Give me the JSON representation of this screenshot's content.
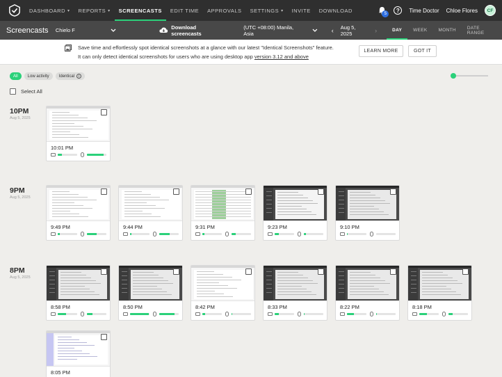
{
  "nav": {
    "items": [
      {
        "label": "DASHBOARD",
        "caret": true
      },
      {
        "label": "REPORTS",
        "caret": true
      },
      {
        "label": "SCREENCASTS",
        "caret": false,
        "active": true
      },
      {
        "label": "EDIT TIME",
        "caret": false
      },
      {
        "label": "APPROVALS",
        "caret": false
      },
      {
        "label": "SETTINGS",
        "caret": true
      },
      {
        "label": "INVITE",
        "caret": false
      },
      {
        "label": "DOWNLOAD",
        "caret": false
      }
    ],
    "notification_count": "5",
    "company": "Time Doctor",
    "user": "Chloe Flores",
    "avatar_initials": "CF"
  },
  "subbar": {
    "title": "Screencasts",
    "selected_user": "Chielo F",
    "download_label": "Download screencasts",
    "timezone": "(UTC +08:00) Manila, Asia",
    "date": "Aug 5, 2025",
    "ranges": [
      "DAY",
      "WEEK",
      "MONTH",
      "DATE RANGE"
    ],
    "active_range": "DAY"
  },
  "banner": {
    "line1": "Save time and effortlessly spot identical screenshots at a glance with our latest \"Identical Screenshots\" feature.",
    "line2_prefix": "It can only detect identical screenshots for users who are using desktop app ",
    "line2_link": "version 3.12 and above",
    "learn_more": "LEARN MORE",
    "got_it": "GOT IT"
  },
  "filters": {
    "all": "All",
    "low_activity": "Low activity",
    "identical": "Identical"
  },
  "select_all": "Select All",
  "accent": "#2bd17a",
  "groups": [
    {
      "hour": "10PM",
      "date": "Aug 5, 2025",
      "cards": [
        {
          "time": "10:01 PM",
          "kb": 0.22,
          "mouse": 0.85,
          "style": "light"
        }
      ]
    },
    {
      "hour": "9PM",
      "date": "Aug 5, 2025",
      "cards": [
        {
          "time": "9:49 PM",
          "kb": 0.12,
          "mouse": 0.5,
          "style": "light"
        },
        {
          "time": "9:44 PM",
          "kb": 0.08,
          "mouse": 0.55,
          "style": "light"
        },
        {
          "time": "9:31 PM",
          "kb": 0.1,
          "mouse": 0.22,
          "style": "green"
        },
        {
          "time": "9:23 PM",
          "kb": 0.2,
          "mouse": 0.12,
          "style": "darkside"
        },
        {
          "time": "9:10 PM",
          "kb": 0.05,
          "mouse": 0.0,
          "style": "dark"
        }
      ]
    },
    {
      "hour": "8PM",
      "date": "Aug 5, 2025",
      "cards": [
        {
          "time": "8:58 PM",
          "kb": 0.42,
          "mouse": 0.3,
          "style": "dark"
        },
        {
          "time": "8:50 PM",
          "kb": 0.95,
          "mouse": 0.8,
          "style": "dark"
        },
        {
          "time": "8:42 PM",
          "kb": 0.15,
          "mouse": 0.05,
          "style": "light"
        },
        {
          "time": "8:33 PM",
          "kb": 0.22,
          "mouse": 0.05,
          "style": "dark"
        },
        {
          "time": "8:22 PM",
          "kb": 0.35,
          "mouse": 0.05,
          "style": "dark"
        },
        {
          "time": "8:18 PM",
          "kb": 0.38,
          "mouse": 0.2,
          "style": "dark"
        },
        {
          "time": "8:05 PM",
          "kb": 0.0,
          "mouse": 0.0,
          "style": "purple"
        }
      ]
    }
  ]
}
